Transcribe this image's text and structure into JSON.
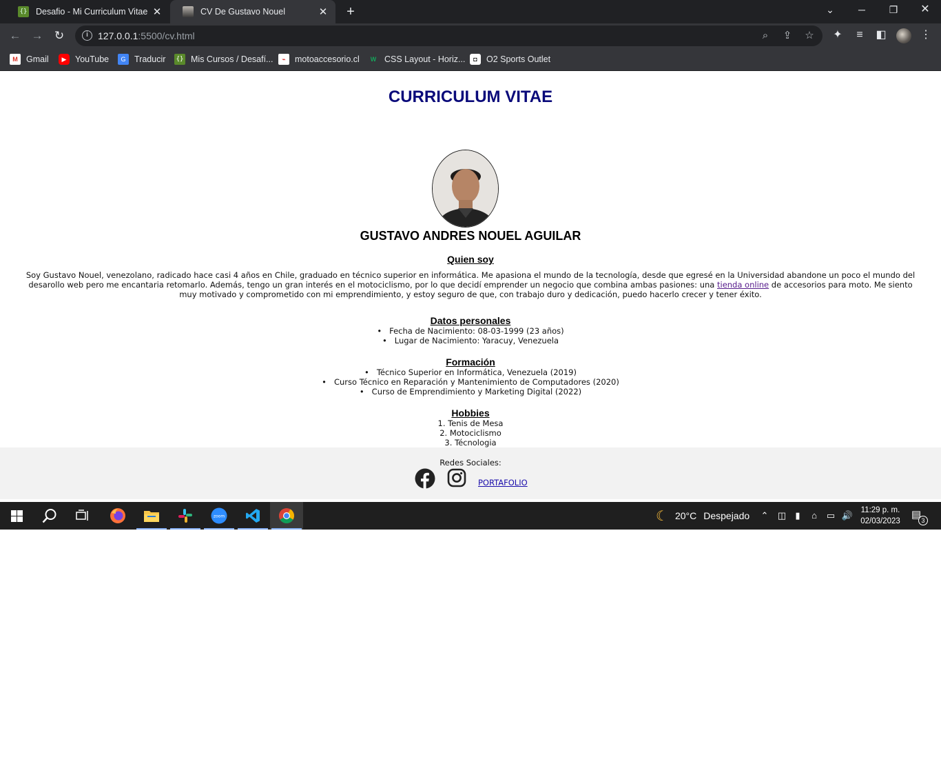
{
  "browser": {
    "tabs": [
      {
        "title": "Desafio - Mi Curriculum Vitae en",
        "active": false
      },
      {
        "title": "CV De Gustavo Nouel",
        "active": true
      }
    ],
    "url_host": "127.0.0.1",
    "url_path": ":5500/cv.html",
    "bookmarks": [
      "Gmail",
      "YouTube",
      "Traducir",
      "Mis Cursos / Desafí...",
      "motoaccesorio.cl",
      "CSS Layout - Horiz...",
      "O2 Sports Outlet"
    ]
  },
  "page": {
    "heading": "CURRICULUM VITAE",
    "name": "GUSTAVO ANDRES NOUEL AGUILAR",
    "about": {
      "title": "Quien soy",
      "text_before_link": "Soy Gustavo Nouel, venezolano, radicado hace casi 4 años en Chile, graduado en técnico superior en informática. Me apasiona el mundo de la tecnología, desde que egresé en la Universidad abandone un poco el mundo del desarollo web pero me encantaria retomarlo. Además, tengo un gran interés en el motociclismo, por lo que decidí emprender un negocio que combina ambas pasiones: una ",
      "link_text": "tienda online",
      "text_after_link": " de accesorios para moto. Me siento muy motivado y comprometido con mi emprendimiento, y estoy seguro de que, con trabajo duro y dedicación, puedo hacerlo crecer y tener éxito."
    },
    "personal": {
      "title": "Datos personales",
      "items": [
        "Fecha de Nacimiento: 08-03-1999 (23 años)",
        "Lugar de Nacimiento: Yaracuy, Venezuela"
      ]
    },
    "education": {
      "title": "Formación",
      "items": [
        "Técnico Superior en Informática, Venezuela (2019)",
        "Curso Técnico en Reparación y Mantenimiento de Computadores (2020)",
        "Curso de Emprendimiento y Marketing Digital (2022)"
      ]
    },
    "hobbies": {
      "title": "Hobbies",
      "items": [
        "1. Tenis de Mesa",
        "2. Motociclismo",
        "3. Técnologia"
      ]
    },
    "footer": {
      "social_label": "Redes Sociales:",
      "portfolio_link": "PORTAFOLIO"
    }
  },
  "taskbar": {
    "weather_temp": "20°C",
    "weather_text": "Despejado",
    "time": "11:29 p. m.",
    "date": "02/03/2023",
    "notification_count": "3"
  },
  "colors": {
    "heading": "#0a0a7a",
    "chrome_dark": "#202124",
    "chrome_toolbar": "#35363a",
    "footer_bg": "#f2f2f2",
    "taskbar_bg": "#1f1f1f"
  }
}
